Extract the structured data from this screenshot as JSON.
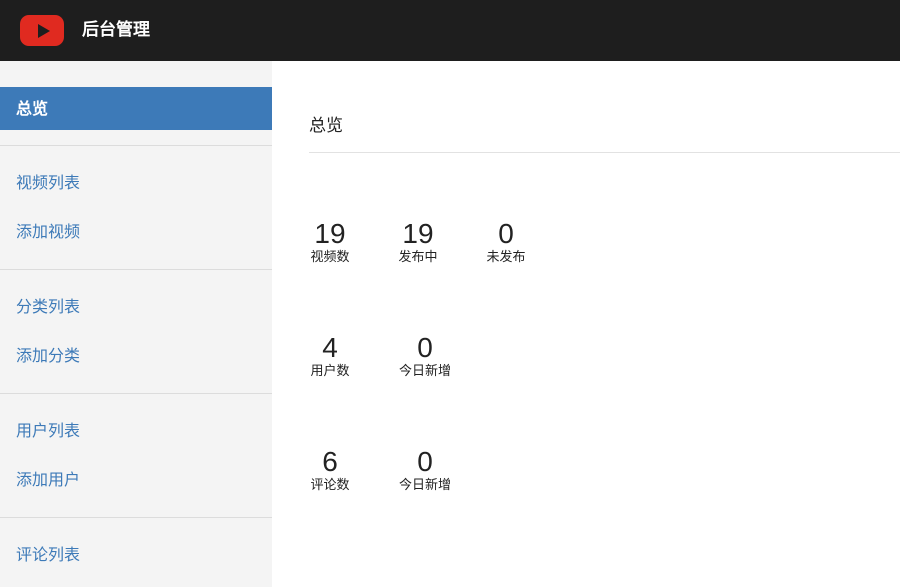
{
  "header": {
    "logo_icon": "youtube-play-icon",
    "title": "后台管理",
    "bg_color": "#1e1e1e",
    "logo_color": "#e02a20"
  },
  "sidebar": {
    "active_color": "#3d7ab8",
    "items": [
      {
        "label": "总览",
        "active": true
      },
      {
        "label": "视频列表"
      },
      {
        "label": "添加视频"
      },
      {
        "label": "分类列表"
      },
      {
        "label": "添加分类"
      },
      {
        "label": "用户列表"
      },
      {
        "label": "添加用户"
      },
      {
        "label": "评论列表"
      }
    ]
  },
  "main": {
    "title": "总览",
    "stat_groups": [
      [
        {
          "value": "19",
          "label": "视频数"
        },
        {
          "value": "19",
          "label": "发布中"
        },
        {
          "value": "0",
          "label": "未发布"
        }
      ],
      [
        {
          "value": "4",
          "label": "用户数"
        },
        {
          "value": "0",
          "label": "今日新增"
        }
      ],
      [
        {
          "value": "6",
          "label": "评论数"
        },
        {
          "value": "0",
          "label": "今日新增"
        }
      ]
    ]
  }
}
